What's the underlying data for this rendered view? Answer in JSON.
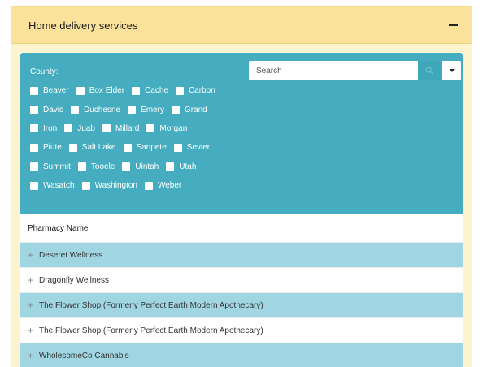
{
  "panel": {
    "title": "Home delivery services"
  },
  "filter": {
    "county_label": "County:",
    "search_placeholder": "Search",
    "county_rows": [
      [
        "Beaver",
        "Box Elder",
        "Cache",
        "Carbon"
      ],
      [
        "Davis",
        "Duchesne",
        "Emery",
        "Grand"
      ],
      [
        "Iron",
        "Juab",
        "Millard",
        "Morgan"
      ],
      [
        "Piute",
        "Salt Lake",
        "Sanpete",
        "Sevier"
      ],
      [
        "Summit",
        "Tooele",
        "Uintah",
        "Utah"
      ],
      [
        "Wasatch",
        "Washington",
        "Weber"
      ]
    ]
  },
  "table": {
    "header": "Pharmacy Name",
    "rows": [
      "Deseret Wellness",
      "Dragonfly Wellness",
      "The Flower Shop (Formerly Perfect Earth Modern Apothecary)",
      "The Flower Shop (Formerly Perfect Earth Modern Apothecary)",
      "WholesomeCo Cannabis"
    ]
  }
}
